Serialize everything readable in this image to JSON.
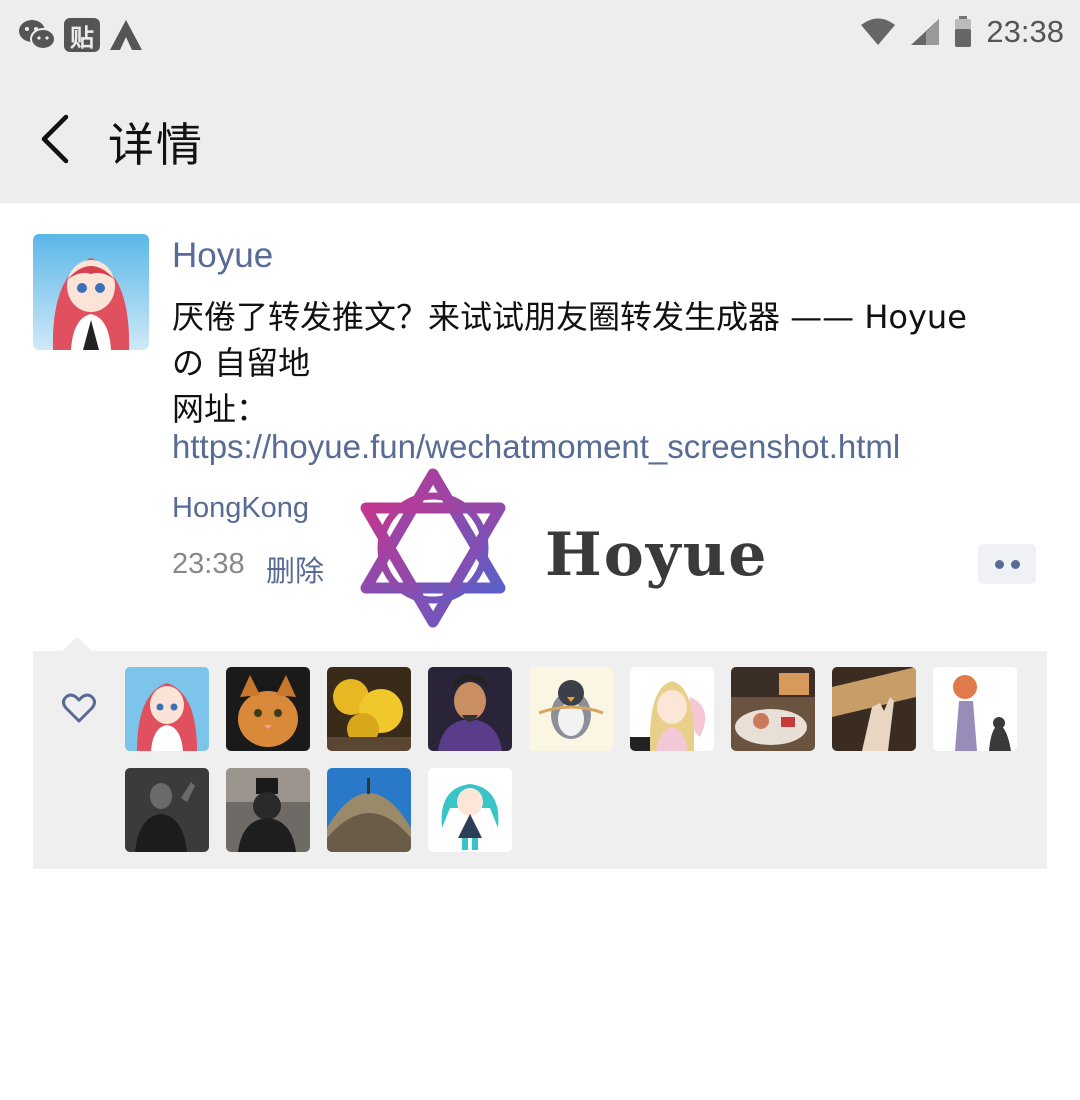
{
  "status_bar": {
    "time": "23:38",
    "left_icons": [
      "wechat-icon",
      "tieba-icon",
      "app-a-icon"
    ],
    "right_icons": [
      "wifi-icon",
      "signal-icon",
      "battery-icon"
    ],
    "tieba_glyph": "贴"
  },
  "nav": {
    "title": "详情"
  },
  "post": {
    "author": "Hoyue",
    "text_lines": [
      "厌倦了转发推文？来试试朋友圈转发生成器 —— Hoyue",
      "の 自留地",
      "网址："
    ],
    "link": "https://hoyue.fun/wechatmoment_screenshot.html",
    "location": "HongKong",
    "time": "23:38",
    "delete_label": "删除"
  },
  "watermark": {
    "text": "Hoyue"
  },
  "likes": {
    "icon": "heart-outline-icon",
    "avatars": [
      "anime-girl-red-hair",
      "orange-cat",
      "yellow-flower-tree",
      "ancient-general",
      "penguin-cartoon",
      "anime-girl-blonde",
      "sleeping-room",
      "hand-shadow",
      "sketch-figure",
      "dark-portrait",
      "masked-figure",
      "desert-dome",
      "anime-miku"
    ]
  },
  "colors": {
    "link_blue": "#576b95",
    "bar_gray": "#ededed",
    "panel_gray": "#efefef",
    "watermark_purple": "#8e3fa8"
  }
}
